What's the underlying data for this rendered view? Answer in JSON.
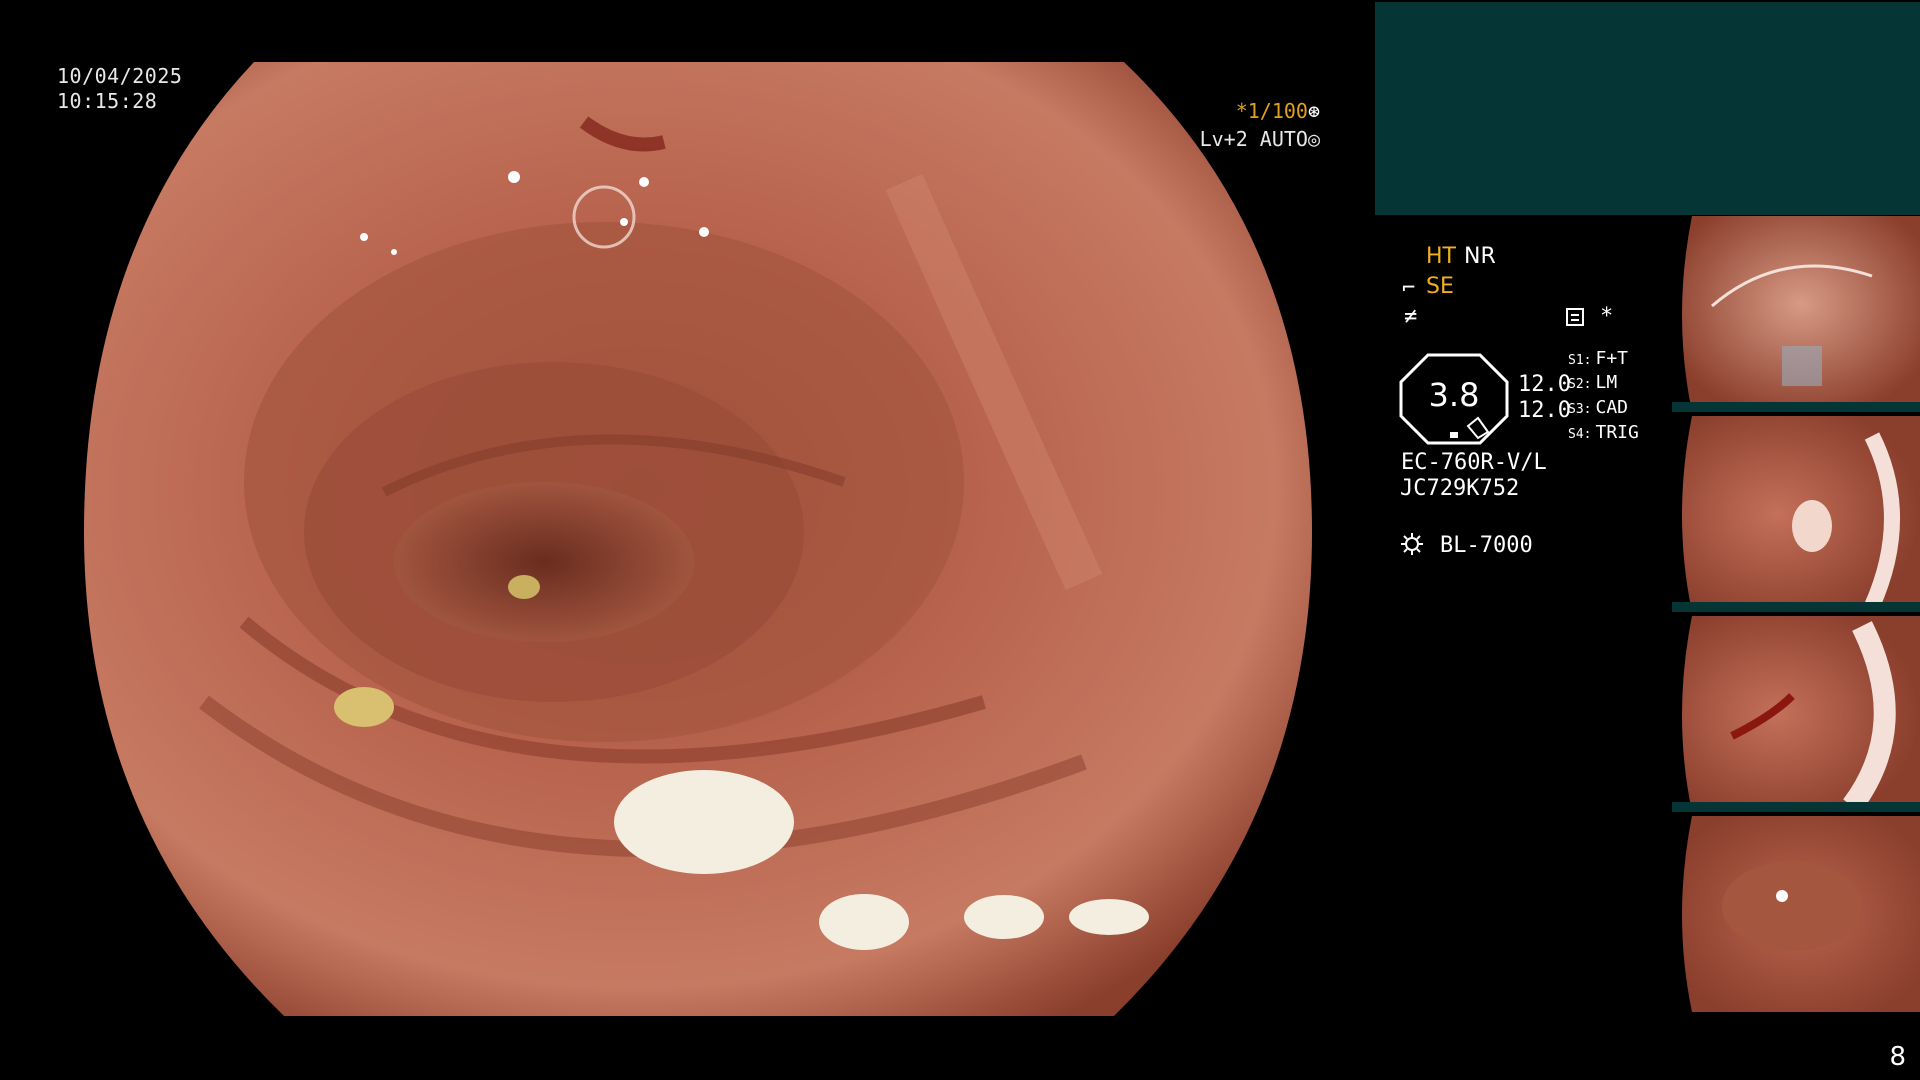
{
  "overlay": {
    "date": "10/04/2025",
    "time": "10:15:28",
    "shutter": "*1/100",
    "level": "Lv+2 AUTO"
  },
  "status": {
    "ht": "HT",
    "nr": "NR",
    "se": "SE",
    "star": "*",
    "octagon_value": "3.8",
    "value_1": "12.0",
    "value_2": "12.0",
    "switches": [
      {
        "key": "S1:",
        "label": "F+T"
      },
      {
        "key": "S2:",
        "label": "LM"
      },
      {
        "key": "S3:",
        "label": "CAD"
      },
      {
        "key": "S4:",
        "label": "TRIG"
      }
    ],
    "scope_model": "EC-760R-V/L",
    "serial": "JC729K752",
    "light_source": "BL-7000"
  },
  "colors": {
    "accent": "#f0b020",
    "panel": "#053535",
    "background": "#000000",
    "mucosa": "#b8644e"
  },
  "icons": [
    "shutter-icon",
    "auto-icon",
    "se-icon",
    "freeze-icon",
    "document-icon",
    "light-bulb-icon"
  ],
  "thumbnails_count": 4,
  "page": "8"
}
